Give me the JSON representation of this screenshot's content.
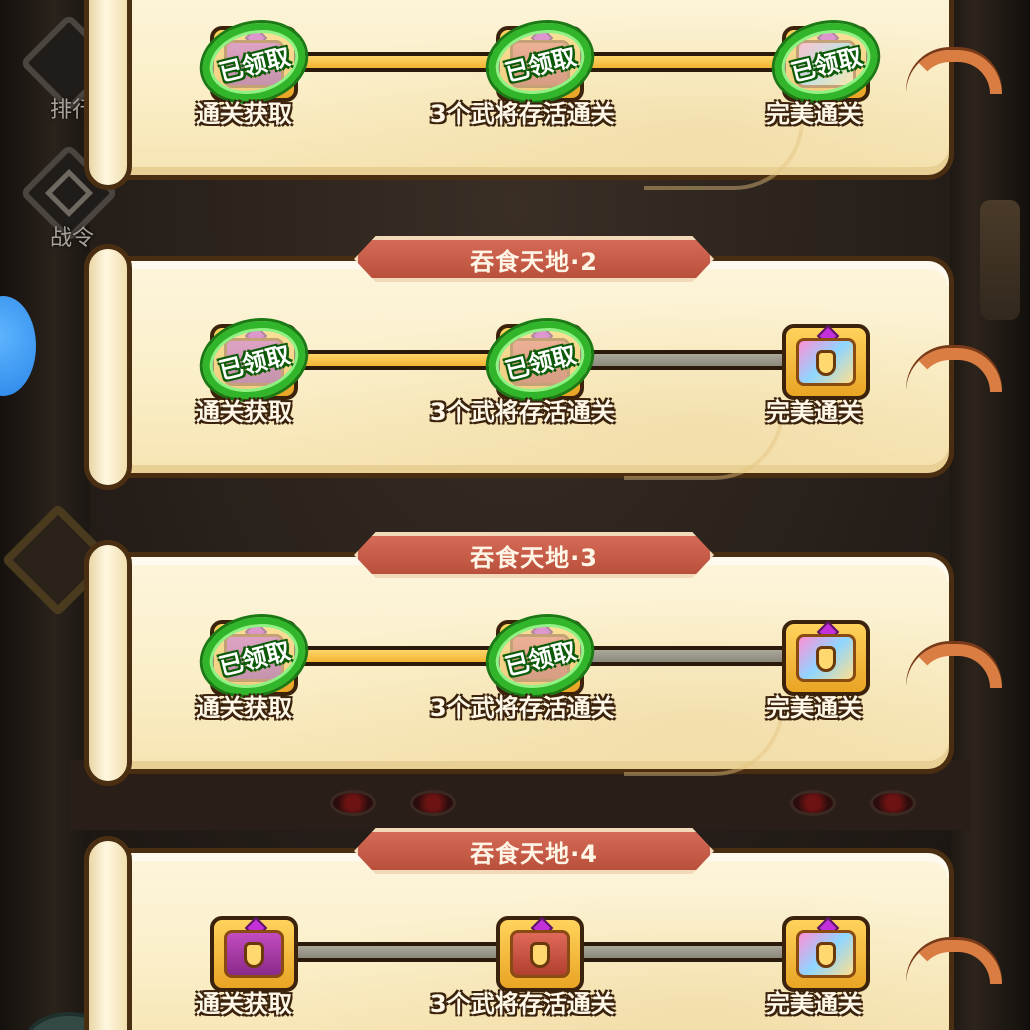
{
  "side_menu": [
    {
      "label": "排行"
    },
    {
      "label": "战令"
    }
  ],
  "stages": [
    {
      "title": "",
      "nodes": [
        {
          "label": "通关获取",
          "claimed": true,
          "claimed_text": "已领取",
          "chest": "purple"
        },
        {
          "label": "3个武将存活通关",
          "claimed": true,
          "claimed_text": "已领取",
          "chest": "red"
        },
        {
          "label": "完美通关",
          "claimed": true,
          "claimed_text": "已领取",
          "chest": "rainbow"
        }
      ],
      "progress": [
        "gold",
        "gold"
      ]
    },
    {
      "title": "吞食天地·2",
      "nodes": [
        {
          "label": "通关获取",
          "claimed": true,
          "claimed_text": "已领取",
          "chest": "purple"
        },
        {
          "label": "3个武将存活通关",
          "claimed": true,
          "claimed_text": "已领取",
          "chest": "red"
        },
        {
          "label": "完美通关",
          "claimed": false,
          "claimed_text": "",
          "chest": "rainbow"
        }
      ],
      "progress": [
        "gold",
        "gray"
      ]
    },
    {
      "title": "吞食天地·3",
      "nodes": [
        {
          "label": "通关获取",
          "claimed": true,
          "claimed_text": "已领取",
          "chest": "purple"
        },
        {
          "label": "3个武将存活通关",
          "claimed": true,
          "claimed_text": "已领取",
          "chest": "red"
        },
        {
          "label": "完美通关",
          "claimed": false,
          "claimed_text": "",
          "chest": "rainbow"
        }
      ],
      "progress": [
        "gold",
        "gray"
      ]
    },
    {
      "title": "吞食天地·4",
      "nodes": [
        {
          "label": "通关获取",
          "claimed": false,
          "claimed_text": "",
          "chest": "purple"
        },
        {
          "label": "3个武将存活通关",
          "claimed": false,
          "claimed_text": "",
          "chest": "red"
        },
        {
          "label": "完美通关",
          "claimed": false,
          "claimed_text": "",
          "chest": "rainbow"
        }
      ],
      "progress": [
        "gray",
        "gray"
      ]
    }
  ],
  "colors": {
    "claimed_stamp": "#31b52a",
    "track_done": "#f3b331",
    "track_pending": "#8b897c",
    "banner": "#c45a45"
  }
}
